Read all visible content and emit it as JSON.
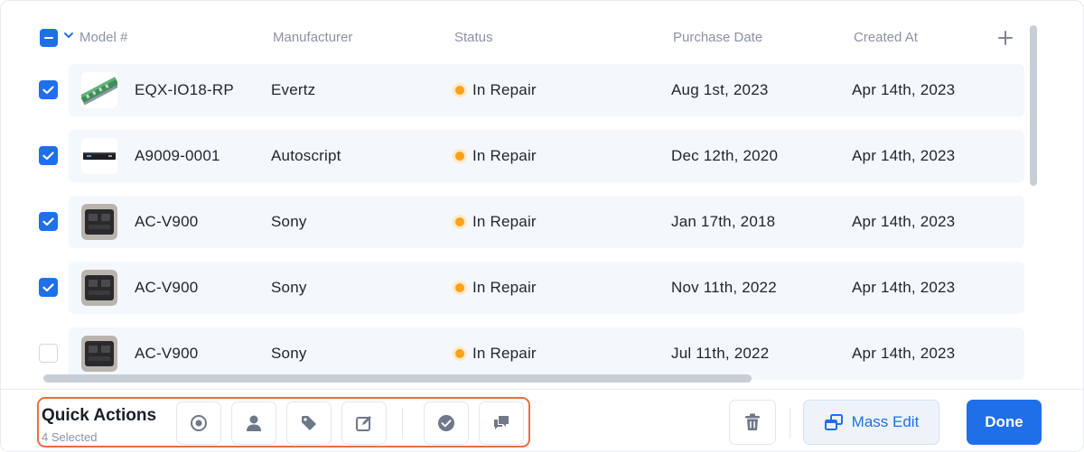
{
  "table": {
    "columns": {
      "model": "Model #",
      "manufacturer": "Manufacturer",
      "status": "Status",
      "purchase_date": "Purchase Date",
      "created_at": "Created At"
    },
    "header_checkbox_state": "indeterminate",
    "rows": [
      {
        "selected": true,
        "thumbnail": "green-rack-card-image",
        "model": "EQX-IO18-RP",
        "manufacturer": "Evertz",
        "status": "In Repair",
        "purchase_date": "Aug 1st, 2023",
        "created_at": "Apr 14th, 2023"
      },
      {
        "selected": true,
        "thumbnail": "black-rack-unit-image",
        "model": "A9009-0001",
        "manufacturer": "Autoscript",
        "status": "In Repair",
        "purchase_date": "Dec 12th, 2020",
        "created_at": "Apr 14th, 2023"
      },
      {
        "selected": true,
        "thumbnail": "black-adapter-image",
        "model": "AC-V900",
        "manufacturer": "Sony",
        "status": "In Repair",
        "purchase_date": "Jan 17th, 2018",
        "created_at": "Apr 14th, 2023"
      },
      {
        "selected": true,
        "thumbnail": "black-adapter-image",
        "model": "AC-V900",
        "manufacturer": "Sony",
        "status": "In Repair",
        "purchase_date": "Nov 11th, 2022",
        "created_at": "Apr 14th, 2023"
      },
      {
        "selected": false,
        "thumbnail": "black-adapter-image",
        "model": "AC-V900",
        "manufacturer": "Sony",
        "status": "In Repair",
        "purchase_date": "Jul 11th, 2022",
        "created_at": "Apr 14th, 2023"
      }
    ]
  },
  "footer": {
    "quick_actions_title": "Quick Actions",
    "selected_count": "4 Selected",
    "quick_action_icons": [
      "status-target-icon",
      "user-icon",
      "tag-icon",
      "edit-icon",
      "check-circle-icon",
      "chat-icon"
    ],
    "mass_edit_label": "Mass Edit",
    "done_label": "Done"
  },
  "colors": {
    "accent": "#1f6fe8",
    "status_in_repair": "#f8a21a",
    "highlight_outline": "#ef6a43",
    "row_background": "#f4f7fb"
  }
}
